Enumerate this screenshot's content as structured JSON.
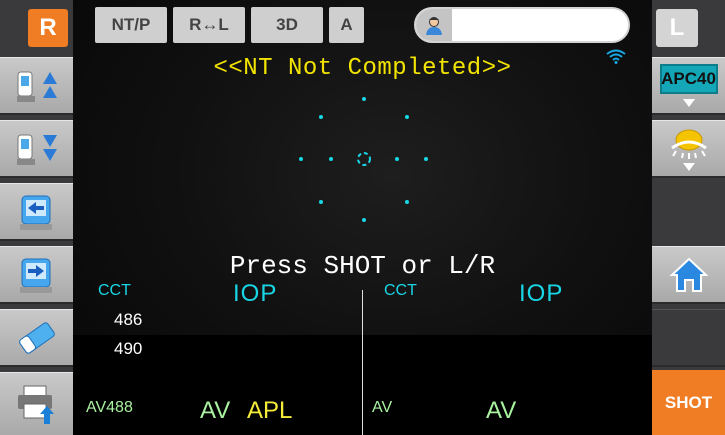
{
  "left_rail": {
    "eye_label": "R"
  },
  "right_rail": {
    "eye_label": "L",
    "apc_label": "APC40",
    "shot_label": "SHOT"
  },
  "toolbar": {
    "ntp_label": "NT/P",
    "swap_label": "R↔L",
    "threed_label": "3D",
    "auto_label": "A",
    "patient_value": ""
  },
  "status": {
    "message": "<<NT Not Completed>>",
    "prompt": "Press SHOT or L/R"
  },
  "right_eye": {
    "cct_label": "CCT",
    "iop_label": "IOP",
    "readings": [
      "486",
      "490"
    ],
    "av_value": "AV488",
    "av_label": "AV",
    "apl_label": "APL"
  },
  "left_eye": {
    "cct_label": "CCT",
    "iop_label": "IOP",
    "av_label_small": "AV",
    "av_label": "AV"
  },
  "colors": {
    "accent": "#f07d23",
    "cyan": "#19d6e6",
    "yellow": "#f2e400",
    "green": "#a9f2a0"
  }
}
